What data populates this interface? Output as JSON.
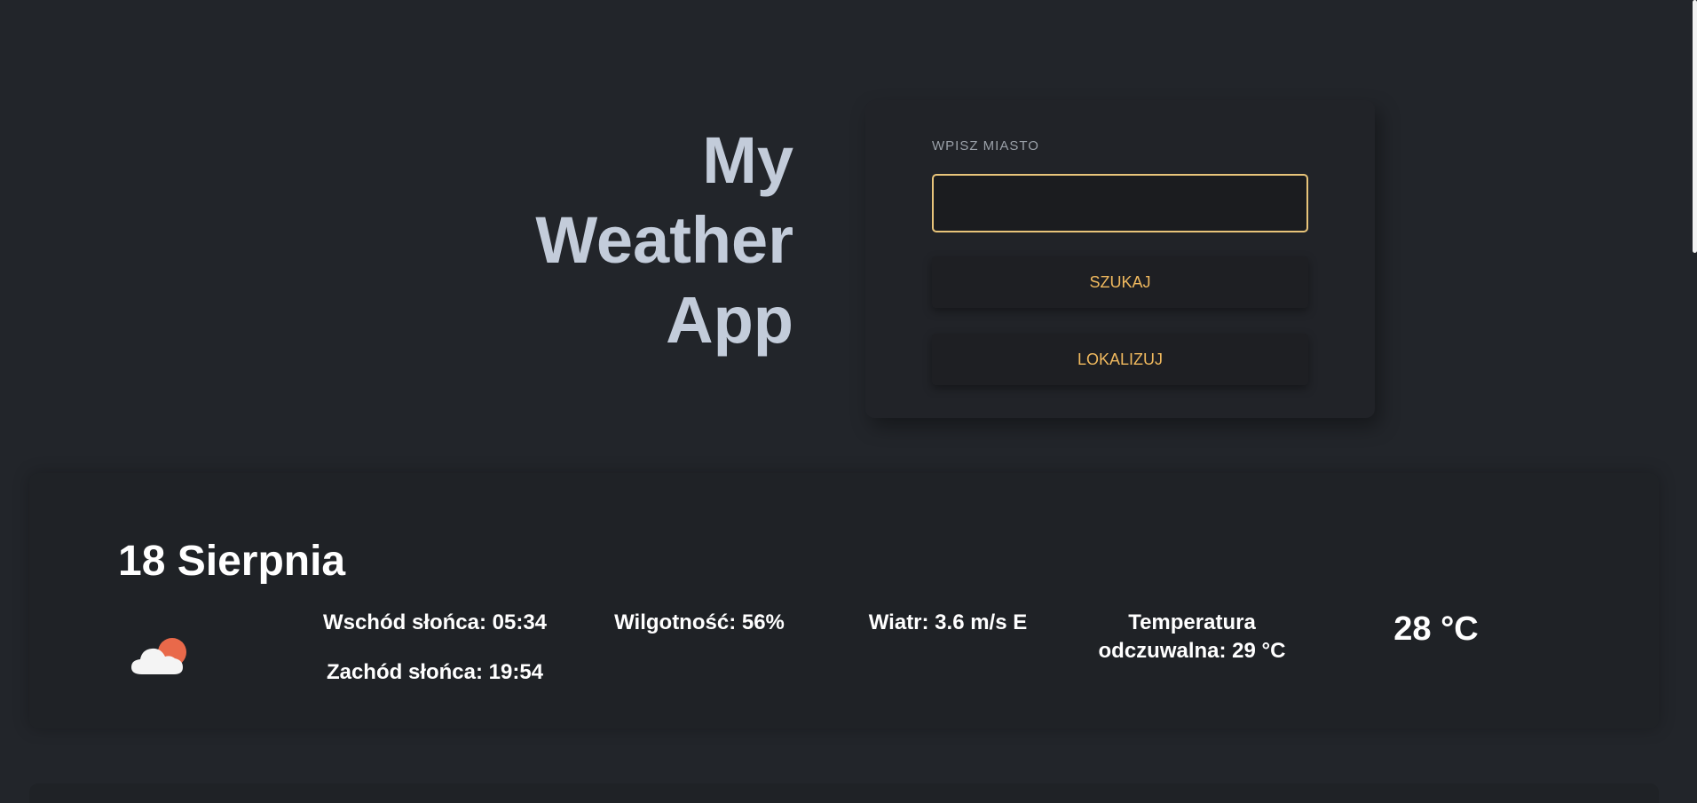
{
  "header": {
    "title": "My Weather App"
  },
  "search": {
    "label": "WPISZ MIASTO",
    "value": "",
    "placeholder": "",
    "search_button": "SZUKAJ",
    "locate_button": "LOKALIZUJ"
  },
  "weather": {
    "date": "18 Sierpnia",
    "icon": "partly-cloudy-icon",
    "sunrise": "Wschód słońca: 05:34",
    "sunset": "Zachód słońca: 19:54",
    "humidity": "Wilgotność: 56%",
    "wind": "Wiatr: 3.6 m/s E",
    "feels_like": "Temperatura odczuwalna: 29 °C",
    "temperature": "28 °C"
  },
  "colors": {
    "background": "#22252a",
    "card": "#1f2226",
    "accent": "#f0b95e",
    "title": "#c3ccda",
    "sun": "#e9694a"
  }
}
